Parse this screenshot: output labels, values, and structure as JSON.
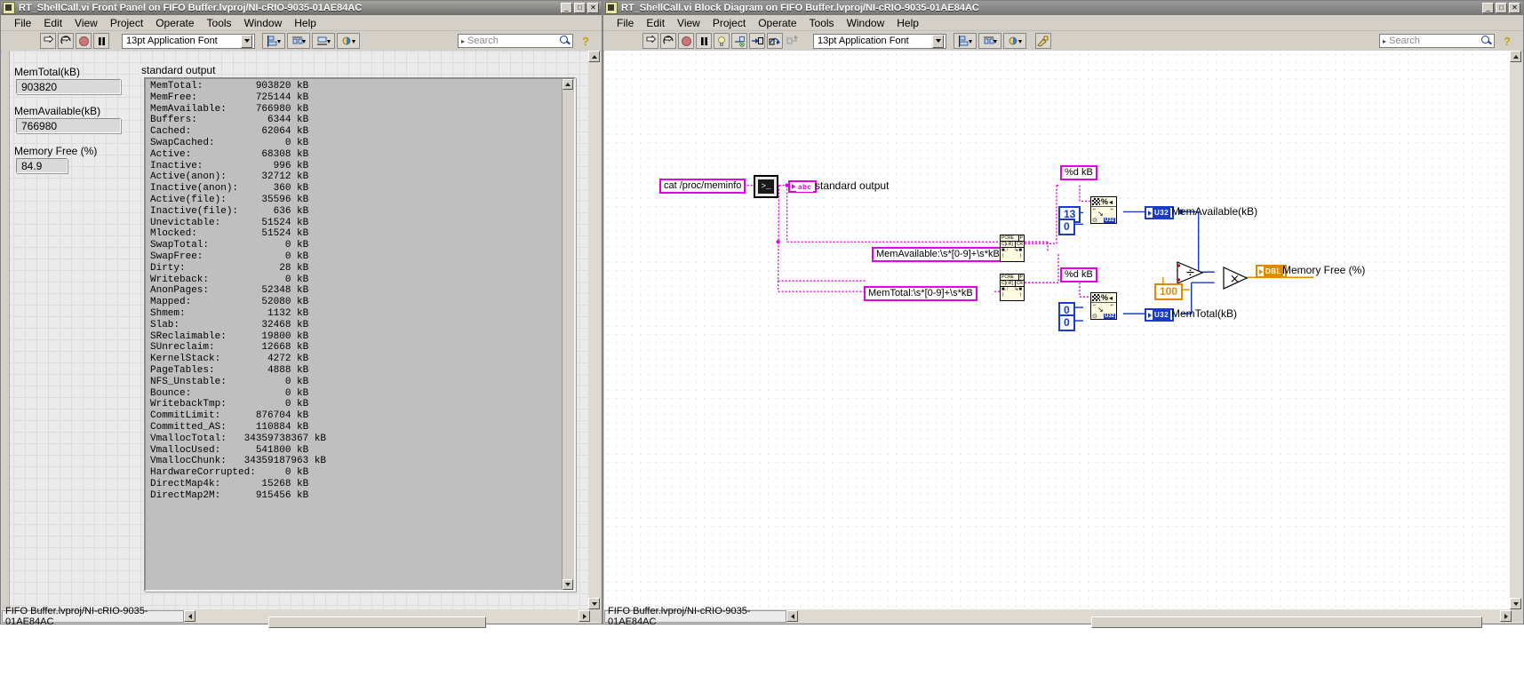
{
  "front_panel": {
    "title": "RT_ShellCall.vi Front Panel on FIFO Buffer.lvproj/NI-cRIO-9035-01AE84AC",
    "menus": [
      "File",
      "Edit",
      "View",
      "Project",
      "Operate",
      "Tools",
      "Window",
      "Help"
    ],
    "toolbar": {
      "font_selector": "13pt Application Font",
      "search_placeholder": "Search",
      "buttons": [
        "run",
        "run-continuously",
        "abort",
        "pause",
        "align-objects",
        "distribute-objects",
        "resize-objects",
        "reorder",
        "help"
      ]
    },
    "controls": [
      {
        "label": "MemTotal(kB)",
        "value": "903820"
      },
      {
        "label": "MemAvailable(kB)",
        "value": "766980"
      },
      {
        "label": "Memory Free (%)",
        "value": "84.9"
      }
    ],
    "standard_output": {
      "label": "standard output",
      "lines": [
        "MemTotal:         903820 kB",
        "MemFree:          725144 kB",
        "MemAvailable:     766980 kB",
        "Buffers:            6344 kB",
        "Cached:            62064 kB",
        "SwapCached:            0 kB",
        "Active:            68308 kB",
        "Inactive:            996 kB",
        "Active(anon):      32712 kB",
        "Inactive(anon):      360 kB",
        "Active(file):      35596 kB",
        "Inactive(file):      636 kB",
        "Unevictable:       51524 kB",
        "Mlocked:           51524 kB",
        "SwapTotal:             0 kB",
        "SwapFree:              0 kB",
        "Dirty:                28 kB",
        "Writeback:             0 kB",
        "AnonPages:         52348 kB",
        "Mapped:            52080 kB",
        "Shmem:              1132 kB",
        "Slab:              32468 kB",
        "SReclaimable:      19800 kB",
        "SUnreclaim:        12668 kB",
        "KernelStack:        4272 kB",
        "PageTables:         4888 kB",
        "NFS_Unstable:          0 kB",
        "Bounce:                0 kB",
        "WritebackTmp:          0 kB",
        "CommitLimit:      876704 kB",
        "Committed_AS:     110884 kB",
        "VmallocTotal:   34359738367 kB",
        "VmallocUsed:      541800 kB",
        "VmallocChunk:   34359187963 kB",
        "HardwareCorrupted:     0 kB",
        "DirectMap4k:       15268 kB",
        "DirectMap2M:      915456 kB"
      ]
    },
    "status_path": "FIFO Buffer.lvproj/NI-cRIO-9035-01AE84AC"
  },
  "block_diagram": {
    "title": "RT_ShellCall.vi Block Diagram on FIFO Buffer.lvproj/NI-cRIO-9035-01AE84AC",
    "menus": [
      "File",
      "Edit",
      "View",
      "Project",
      "Operate",
      "Tools",
      "Window",
      "Help"
    ],
    "toolbar": {
      "font_selector": "13pt Application Font",
      "search_placeholder": "Search",
      "buttons": [
        "run",
        "run-continuously",
        "abort",
        "pause",
        "highlight-execution",
        "retain-wire-values",
        "step-into",
        "step-over",
        "step-out",
        "align-objects",
        "distribute-objects",
        "reorder",
        "clean-up-diagram",
        "help"
      ]
    },
    "nodes": {
      "command_constant": "cat /proc/meminfo",
      "sysexec_label": "standard output",
      "regex_available": "MemAvailable:\\s*[0-9]+\\s*kB",
      "regex_total": "MemTotal:\\s*[0-9]+\\s*kB",
      "format_available": "%d kB",
      "format_total": "%d kB",
      "const_13": "13",
      "const_0_a": "0",
      "const_0_b": "0",
      "const_0_c": "0",
      "const_100": "100",
      "indicator_available": "MemAvailable(kB)",
      "indicator_total": "MemTotal(kB)",
      "indicator_free": "Memory Free (%)",
      "type_u32": "U32",
      "type_dbl": "DBL",
      "type_abc": "abc",
      "pcre_label_1": "PCRE",
      "pcre_label_2": "C[r,R]",
      "divide_symbol": "÷",
      "multiply_symbol": "×",
      "percent_symbol": "%"
    },
    "status_path": "FIFO Buffer.lvproj/NI-cRIO-9035-01AE84AC"
  },
  "colors": {
    "magenta_string": "#e000e0",
    "blue_int": "#1a3cc8",
    "orange_dbl": "#e08a00",
    "chrome": "#d4d0c8"
  }
}
